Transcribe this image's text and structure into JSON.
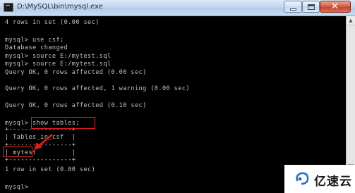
{
  "window": {
    "title": "D:\\MySQL\\bin\\mysql.exe"
  },
  "console": {
    "lines": [
      "4 rows in set (0.00 sec)",
      "",
      "mysql> use csf;",
      "Database changed",
      "mysql> source E:/mytest.sql",
      "mysql> source E:/mytest.sql",
      "Query OK, 0 rows affected (0.00 sec)",
      "",
      "Query OK, 0 rows affected, 1 warning (0.00 sec)",
      "",
      "Query OK, 0 rows affected (0.10 sec)",
      "",
      "mysql> show tables;",
      "+----------------+",
      "| Tables_in_csf  |",
      "+----------------+",
      "| mytest         |",
      "+----------------+",
      "1 row in set (0.00 sec)",
      "",
      "mysql>"
    ]
  },
  "watermark": {
    "text": "亿速云"
  },
  "colors": {
    "console_bg": "#000000",
    "console_text": "#c0c0c0",
    "highlight": "#e02020",
    "titlebar": "#c2d8f0"
  }
}
